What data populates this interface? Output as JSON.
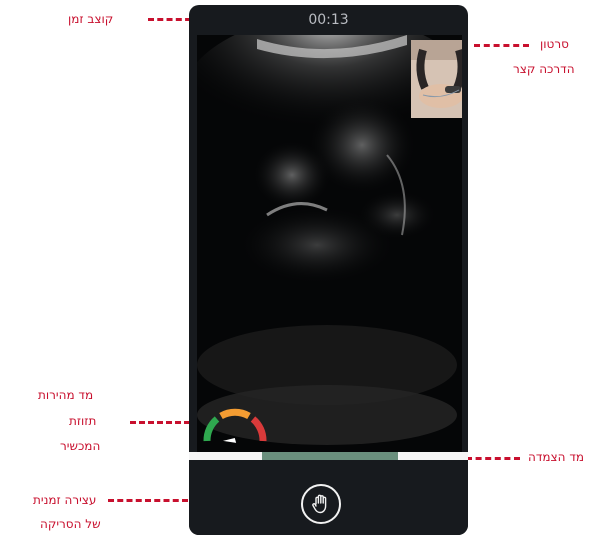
{
  "timer": {
    "value": "00:13"
  },
  "session_progress": {
    "start_fraction": 0.26,
    "end_fraction": 0.75
  },
  "speed_gauge": {
    "level_fraction": 0.2
  },
  "annotations": {
    "timer_rate": "קוצב זמן",
    "tutorial_line1": "סרטון",
    "tutorial_line2": "הדרכה קצר",
    "speed_line1": "מד מהירות",
    "speed_line2": "תזוזת",
    "speed_line3": "המכשיר",
    "adhesion": "מד הצמדה",
    "pause_line1": "עצירה זמנית",
    "pause_line2": "של הסריקה"
  },
  "colors": {
    "annotation": "#c8102e",
    "progress_fill": "#6a8f7d",
    "gauge": [
      "#2fa84f",
      "#f39c32",
      "#d93a3a"
    ]
  },
  "icons": {
    "pause": "hand-icon"
  }
}
